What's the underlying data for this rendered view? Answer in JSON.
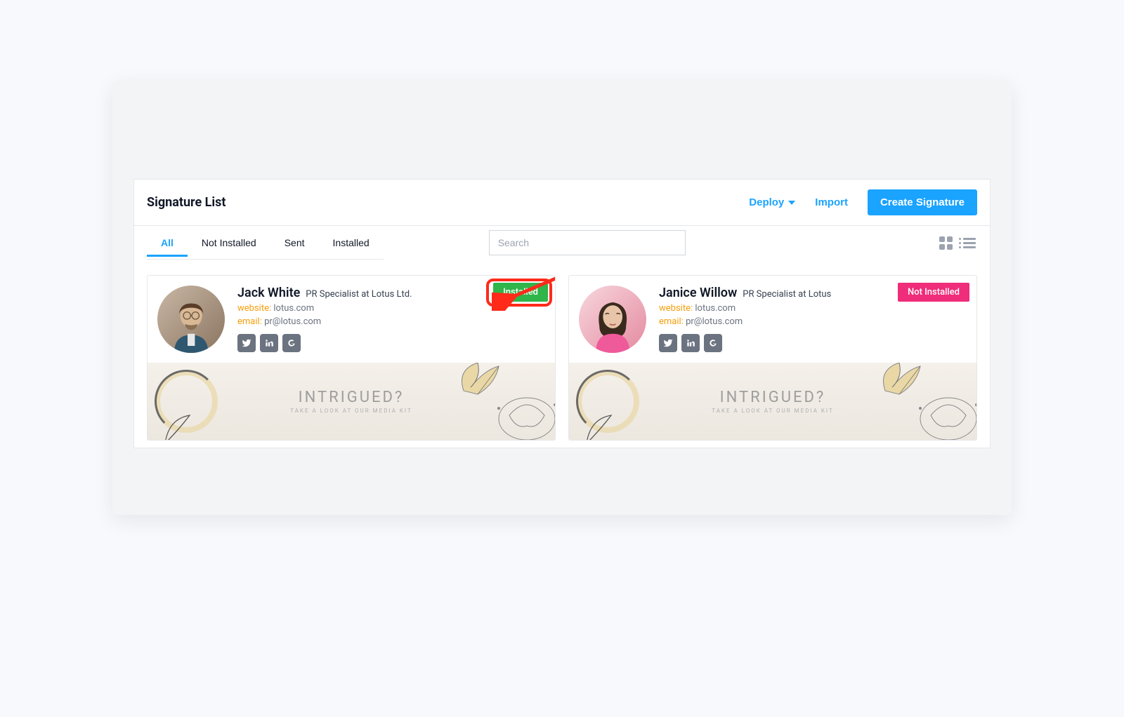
{
  "header": {
    "title": "Signature List",
    "deploy_label": "Deploy",
    "import_label": "Import",
    "create_label": "Create Signature"
  },
  "tabs": {
    "all": "All",
    "not_installed": "Not Installed",
    "sent": "Sent",
    "installed": "Installed",
    "active": "all"
  },
  "search": {
    "placeholder": "Search"
  },
  "signatures": [
    {
      "name": "Jack White",
      "role": "PR Specialist at Lotus Ltd.",
      "website_label": "website:",
      "website_value": "lotus.com",
      "email_label": "email:",
      "email_value": "pr@lotus.com",
      "status": "Installed",
      "status_type": "installed",
      "banner_title": "INTRIGUED?",
      "banner_sub": "TAKE A LOOK AT OUR MEDIA KIT"
    },
    {
      "name": "Janice Willow",
      "role": "PR Specialist at Lotus",
      "website_label": "website:",
      "website_value": "lotus.com",
      "email_label": "email:",
      "email_value": "pr@lotus.com",
      "status": "Not Installed",
      "status_type": "not-installed",
      "banner_title": "INTRIGUED?",
      "banner_sub": "TAKE A LOOK AT OUR MEDIA KIT"
    }
  ],
  "colors": {
    "accent": "#1aa3ff",
    "installed": "#2fb54a",
    "not_installed": "#ef2d7a",
    "highlight": "#ff2a1a"
  }
}
